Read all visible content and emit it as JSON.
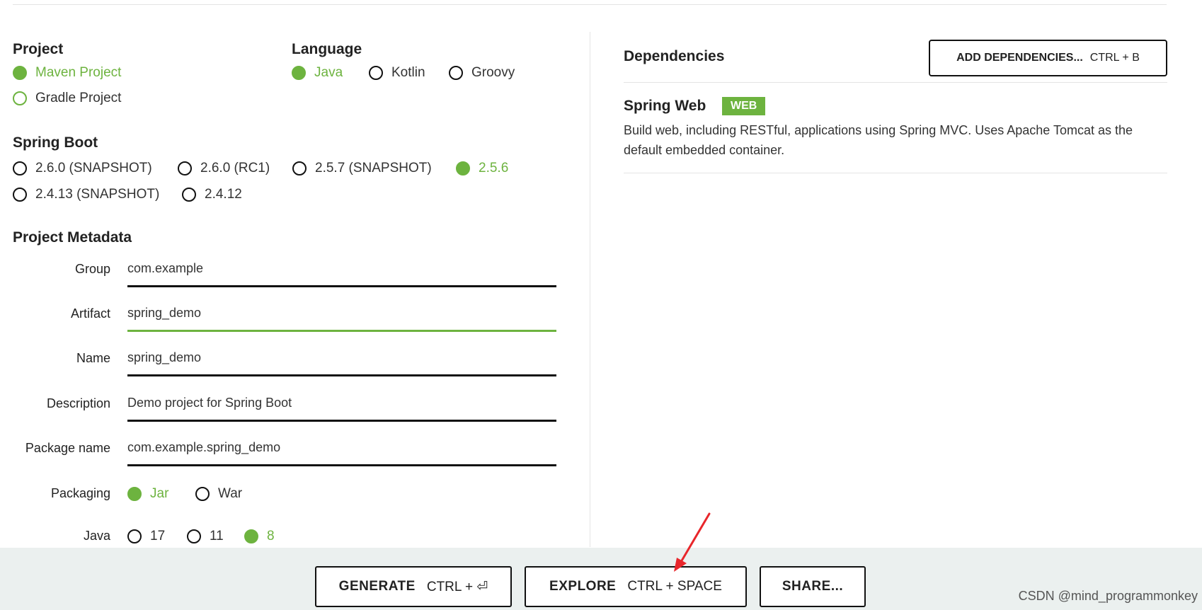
{
  "sections": {
    "project": "Project",
    "language": "Language",
    "spring_boot": "Spring Boot",
    "metadata": "Project Metadata",
    "dependencies": "Dependencies"
  },
  "project_options": [
    {
      "label": "Maven Project",
      "checked": true
    },
    {
      "label": "Gradle Project",
      "checked": false
    }
  ],
  "language_options": [
    {
      "label": "Java",
      "checked": true
    },
    {
      "label": "Kotlin",
      "checked": false
    },
    {
      "label": "Groovy",
      "checked": false
    }
  ],
  "boot_versions": [
    {
      "label": "2.6.0 (SNAPSHOT)",
      "checked": false
    },
    {
      "label": "2.6.0 (RC1)",
      "checked": false
    },
    {
      "label": "2.5.7 (SNAPSHOT)",
      "checked": false
    },
    {
      "label": "2.5.6",
      "checked": true
    },
    {
      "label": "2.4.13 (SNAPSHOT)",
      "checked": false
    },
    {
      "label": "2.4.12",
      "checked": false
    }
  ],
  "metadata": {
    "group": {
      "label": "Group",
      "value": "com.example"
    },
    "artifact": {
      "label": "Artifact",
      "value": "spring_demo"
    },
    "name": {
      "label": "Name",
      "value": "spring_demo"
    },
    "description": {
      "label": "Description",
      "value": "Demo project for Spring Boot"
    },
    "package_name": {
      "label": "Package name",
      "value": "com.example.spring_demo"
    },
    "packaging": {
      "label": "Packaging",
      "options": [
        {
          "label": "Jar",
          "checked": true
        },
        {
          "label": "War",
          "checked": false
        }
      ]
    },
    "java": {
      "label": "Java",
      "options": [
        {
          "label": "17",
          "checked": false
        },
        {
          "label": "11",
          "checked": false
        },
        {
          "label": "8",
          "checked": true
        }
      ]
    }
  },
  "add_dependencies": {
    "label": "ADD DEPENDENCIES...",
    "shortcut": "CTRL + B"
  },
  "dependency": {
    "name": "Spring Web",
    "badge": "WEB",
    "description": "Build web, including RESTful, applications using Spring MVC. Uses Apache Tomcat as the default embedded container."
  },
  "footer": {
    "generate": {
      "label": "GENERATE",
      "shortcut": "CTRL + ⏎"
    },
    "explore": {
      "label": "EXPLORE",
      "shortcut": "CTRL + SPACE"
    },
    "share": {
      "label": "SHARE..."
    }
  },
  "watermark": "CSDN @mind_programmonkey",
  "colors": {
    "accent": "#6db33f",
    "footer_bg": "#ebf0ef",
    "arrow": "#e8262b"
  }
}
